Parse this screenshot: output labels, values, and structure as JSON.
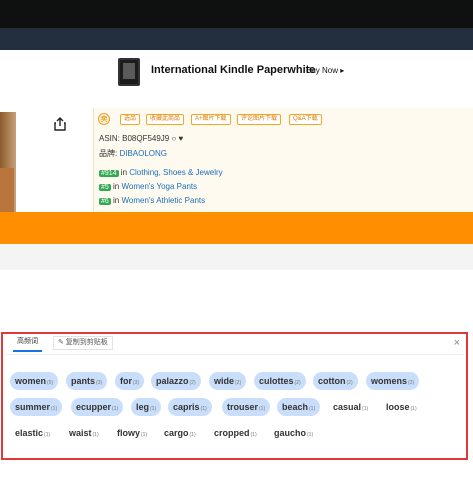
{
  "promo": {
    "title": "International Kindle Paperwhite",
    "buy_label": "Buy Now ▸"
  },
  "plugin": {
    "logo": "卖",
    "buttons": [
      "选品",
      "收藏此商品",
      "A+图片下载",
      "评论图片下载",
      "Q&A下载"
    ],
    "asin": "ASIN: B08QF549J9 ○ ♥",
    "brand_label": "品牌: ",
    "brand_value": "DIBAOLONG",
    "ranks": [
      {
        "num": "#914",
        "in": " in ",
        "cat": "Clothing, Shoes & Jewelry"
      },
      {
        "num": "#5",
        "in": " in ",
        "cat": "Women's Yoga Pants"
      },
      {
        "num": "#6",
        "in": " in ",
        "cat": "Women's Athletic Pants"
      }
    ]
  },
  "keywords_panel": {
    "tab_active": "高频词",
    "tab_copy": "✎ 复制到剪贴板",
    "close": "×",
    "keywords": [
      {
        "word": "women",
        "count": "(5)",
        "highlight": true
      },
      {
        "word": "pants",
        "count": "(3)",
        "highlight": true
      },
      {
        "word": "for",
        "count": "(3)",
        "highlight": true
      },
      {
        "word": "palazzo",
        "count": "(2)",
        "highlight": true
      },
      {
        "word": "wide",
        "count": "(2)",
        "highlight": true
      },
      {
        "word": "culottes",
        "count": "(2)",
        "highlight": true
      },
      {
        "word": "cotton",
        "count": "(2)",
        "highlight": true
      },
      {
        "word": "womens",
        "count": "(2)",
        "highlight": true
      },
      {
        "word": "summer",
        "count": "(1)",
        "highlight": true
      },
      {
        "word": "ecupper",
        "count": "(1)",
        "highlight": true
      },
      {
        "word": "leg",
        "count": "(1)",
        "highlight": true
      },
      {
        "word": "capris",
        "count": "(1)",
        "highlight": true
      },
      {
        "word": "trouser",
        "count": "(1)",
        "highlight": true
      },
      {
        "word": "beach",
        "count": "(1)",
        "highlight": true
      },
      {
        "word": "casual",
        "count": "(1)",
        "highlight": false
      },
      {
        "word": "loose",
        "count": "(1)",
        "highlight": false
      },
      {
        "word": "elastic",
        "count": "(1)",
        "highlight": false
      },
      {
        "word": "waist",
        "count": "(1)",
        "highlight": false
      },
      {
        "word": "flowy",
        "count": "(1)",
        "highlight": false
      },
      {
        "word": "cargo",
        "count": "(1)",
        "highlight": false
      },
      {
        "word": "cropped",
        "count": "(1)",
        "highlight": false
      },
      {
        "word": "gaucho",
        "count": "(1)",
        "highlight": false
      }
    ]
  },
  "colors": {
    "orange_bar": "#ff8f00",
    "panel_border": "#e0393a",
    "chip_highlight": "#c9defa",
    "link": "#1a6fb8"
  }
}
